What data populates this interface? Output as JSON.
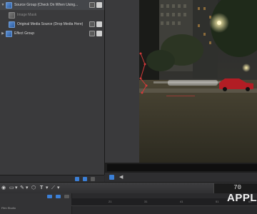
{
  "layers": {
    "rows": [
      {
        "label": "Source Group (Check On When Using..."
      },
      {
        "label": "Image Mask"
      },
      {
        "label": "Original Media Source (Drop Media Here)"
      },
      {
        "label": "Effect Group"
      }
    ]
  },
  "toolbar": {
    "text_tool": "T",
    "display_value": "70"
  },
  "timeline": {
    "ticks": [
      "21",
      "31",
      "41",
      "51",
      "61"
    ],
    "track_label": "Film Studio"
  },
  "watermark": "APPL",
  "colors": {
    "accent_blue": "#3b7fd6",
    "mask_red": "#d23a3a",
    "panel_bg": "#3a3a3c"
  },
  "icons": [
    "disclosure-triangle",
    "group-icon",
    "mask-icon",
    "media-icon",
    "checkbox-icon",
    "lock-icon",
    "play-icon",
    "shape-tool-icon",
    "text-tool-icon"
  ]
}
